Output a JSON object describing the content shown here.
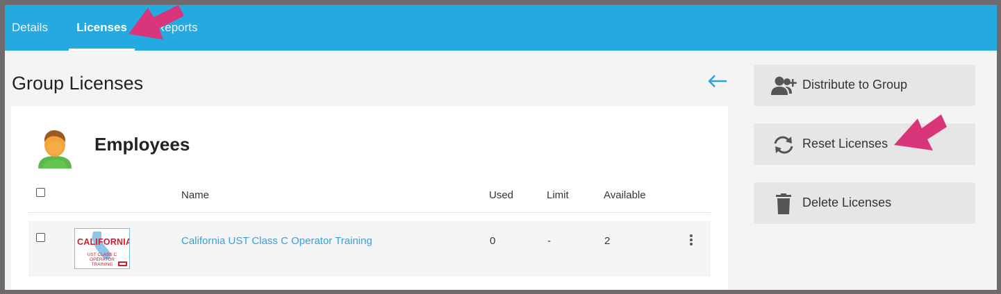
{
  "tabs": [
    {
      "label": "Details",
      "active": false
    },
    {
      "label": "Licenses",
      "active": true
    },
    {
      "label": "Reports",
      "active": false
    }
  ],
  "page_title": "Group Licenses",
  "group": {
    "name": "Employees"
  },
  "table": {
    "columns": [
      "Name",
      "Used",
      "Limit",
      "Available"
    ],
    "rows": [
      {
        "name": "California UST Class C Operator Training",
        "used": "0",
        "limit": "-",
        "available": "2",
        "thumbnail": {
          "title": "CALIFORNIA",
          "line1": "UST CLASS C",
          "line2": "OPERATOR",
          "line3": "TRAINING"
        }
      }
    ]
  },
  "actions": [
    {
      "label": "Distribute to Group",
      "icon": "user-plus-icon"
    },
    {
      "label": "Reset Licenses",
      "icon": "sync-icon"
    },
    {
      "label": "Delete Licenses",
      "icon": "trash-icon"
    }
  ],
  "colors": {
    "accent": "#24a9e1",
    "link": "#3a9fd8",
    "annotation": "#d8357a"
  }
}
